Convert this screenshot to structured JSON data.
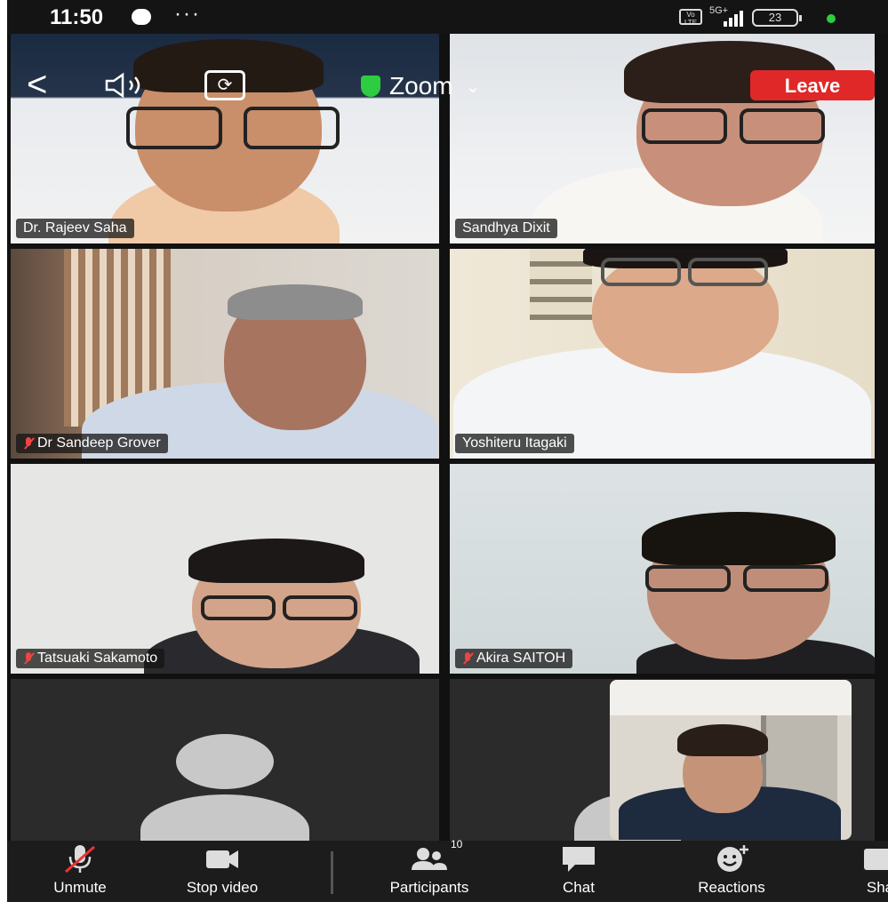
{
  "status_bar": {
    "time": "11:50",
    "more": "···",
    "network": "5G+",
    "volte": "Vo LTE",
    "battery": "23"
  },
  "meeting": {
    "title": "Zoom",
    "leave_label": "Leave",
    "accent_green": "#34c759",
    "leave_color": "#e02828"
  },
  "participants": [
    {
      "name": "Dr. Rajeev Saha",
      "muted": false,
      "active_speaker": false
    },
    {
      "name": "Sandhya Dixit",
      "muted": false,
      "active_speaker": false
    },
    {
      "name": "Dr Sandeep Grover",
      "muted": true,
      "active_speaker": false
    },
    {
      "name": "Yoshiteru Itagaki",
      "muted": false,
      "active_speaker": true
    },
    {
      "name": "Tatsuaki Sakamoto",
      "muted": true,
      "active_speaker": false
    },
    {
      "name": "Akira SAITOH",
      "muted": true,
      "active_speaker": false
    }
  ],
  "toolbar": {
    "unmute_label": "Unmute",
    "stop_video_label": "Stop video",
    "participants_label": "Participants",
    "participants_count": "10",
    "chat_label": "Chat",
    "reactions_label": "Reactions",
    "share_label": "Sha"
  }
}
